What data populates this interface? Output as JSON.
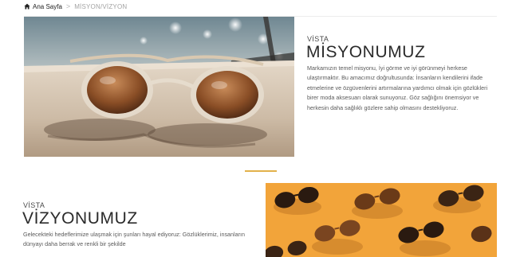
{
  "breadcrumb": {
    "home_icon": "home-icon",
    "home_label": "Ana Sayfa",
    "separator": ">",
    "current": "MİSYON/VİZYON"
  },
  "mission": {
    "eyebrow": "VİSTA",
    "title": "MİSYONUMUZ",
    "text": "Markamızın temel misyonu, İyi görme ve iyi görünmeyi herkese ulaştırmaktır. Bu amacımız doğrultusunda: İnsanların kendilerini ifade etmelerine ve özgüvenlerini artırmalarına yardımcı olmak için gözlükleri birer moda aksesuarı olarak sunuyoruz. Göz sağlığını önemsiyor ve herkesin daha sağlıklı gözlere sahip olmasını destekliyoruz."
  },
  "vision": {
    "eyebrow": "VİSTA",
    "title": "VİZYONUMUZ",
    "text": "Gelecekteki hedeflerimize ulaşmak için şunları hayal ediyoruz: Gözlüklerimiz, insanların dünyayı daha berrak ve renkli bir şekilde"
  },
  "colors": {
    "accent": "#e2b14a",
    "heading": "#2b2b2b",
    "body_text": "#5a5a5a",
    "breadcrumb_current": "#a3a3a3",
    "photo2_background": "#f2a43a"
  },
  "images": {
    "mission_photo": "sunglasses-on-deck-photo",
    "vision_photo": "sunglasses-pattern-on-orange-photo"
  }
}
